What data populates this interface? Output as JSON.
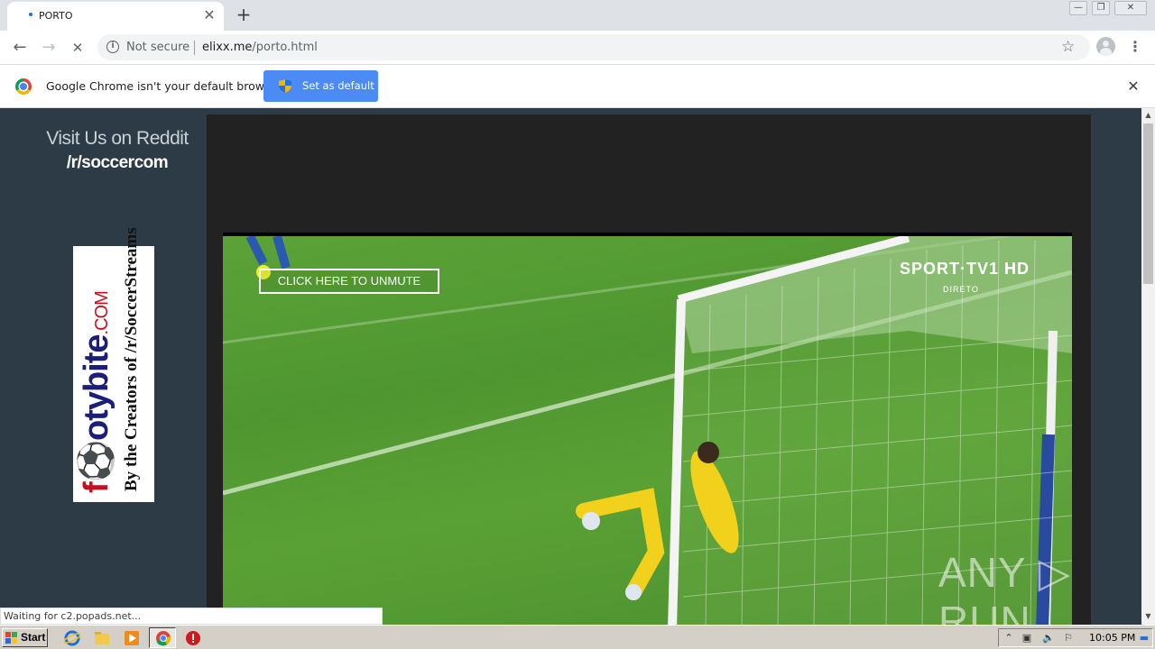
{
  "browser": {
    "tab": {
      "title": "PORTO",
      "close": "✕"
    },
    "new_tab": "+",
    "window_controls": {
      "minimize": "—",
      "restore": "❐",
      "close": "✕"
    },
    "address_bar": {
      "security_label": "Not secure",
      "url_host": "elixx.me",
      "url_path": "/porto.html"
    },
    "nav": {
      "back": "←",
      "forward": "→",
      "stop": "✕"
    },
    "status_text": "Waiting for c2.popads.net..."
  },
  "infobar": {
    "message": "Google Chrome isn't your default browser",
    "button_label": "Set as default",
    "close": "✕"
  },
  "page": {
    "reddit_promo": {
      "line1": "Visit Us on Reddit",
      "line2": "/r/soccercom"
    },
    "ad_banner": {
      "brand_prefix": "f",
      "brand_main": "⚽otybite",
      "brand_suffix": ".COM",
      "tagline": "By the Creators of /r/SoccerStreams"
    },
    "video": {
      "unmute_label": "CLICK HERE TO UNMUTE",
      "broadcaster": "SPORT·TV1 HD",
      "broadcaster_sub": "DIRETO"
    }
  },
  "watermark": "ANY ▷ RUN",
  "taskbar": {
    "start_label": "Start",
    "clock": "10:05 PM"
  },
  "colors": {
    "page_bg": "#2c3b45",
    "player_bg": "#222222",
    "infobar_button": "#4c8bf5",
    "pitch_green": "#5ba338"
  }
}
